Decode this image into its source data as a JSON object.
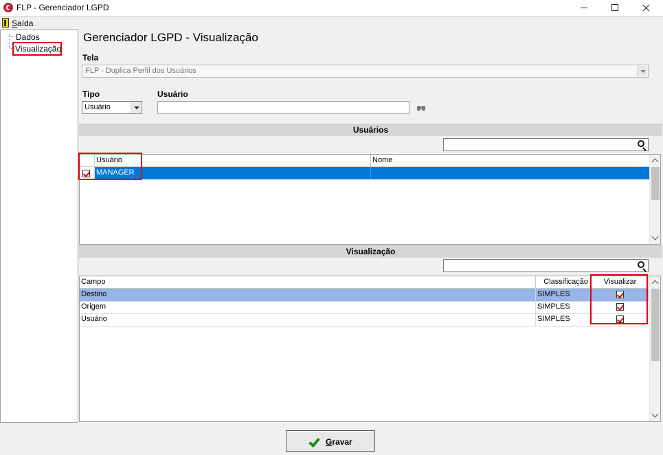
{
  "window": {
    "title": "FLP - Gerenciador LGPD"
  },
  "menu": {
    "exit_prefix": "S",
    "exit_rest": "aída"
  },
  "tree": {
    "items": [
      "Dados",
      "Visualização"
    ]
  },
  "main": {
    "title": "Gerenciador LGPD - Visualização",
    "tela_label": "Tela",
    "tela_value": "FLP - Duplica Perfil dos Usuários",
    "tipo_label": "Tipo",
    "tipo_value": "Usuário",
    "usuario_label": "Usuário",
    "usuario_value": ""
  },
  "usuarios": {
    "section_title": "Usuários",
    "search_value": "",
    "columns": [
      "Usuário",
      "Nome"
    ],
    "rows": [
      {
        "usuario": "MANAGER",
        "nome": "",
        "checked": true
      }
    ]
  },
  "visualizacao": {
    "section_title": "Visualização",
    "search_value": "",
    "columns": [
      "Campo",
      "Classificação",
      "Visualizar"
    ],
    "rows": [
      {
        "campo": "Destino",
        "classificacao": "SIMPLES",
        "visualizar": true
      },
      {
        "campo": "Origem",
        "classificacao": "SIMPLES",
        "visualizar": true
      },
      {
        "campo": "Usuário",
        "classificacao": "SIMPLES",
        "visualizar": true
      }
    ]
  },
  "footer": {
    "save_prefix": "G",
    "save_rest": "ravar"
  },
  "colors": {
    "selection": "#0078d7",
    "row_highlight": "#99b4e6",
    "highlight_box": "#e00010",
    "check": "#d00000",
    "save_icon": "#1a8a1a"
  },
  "icons": [
    "app-logo-icon",
    "exit-door-icon",
    "binoculars-icon",
    "magnifier-icon",
    "checkmark-icon"
  ]
}
